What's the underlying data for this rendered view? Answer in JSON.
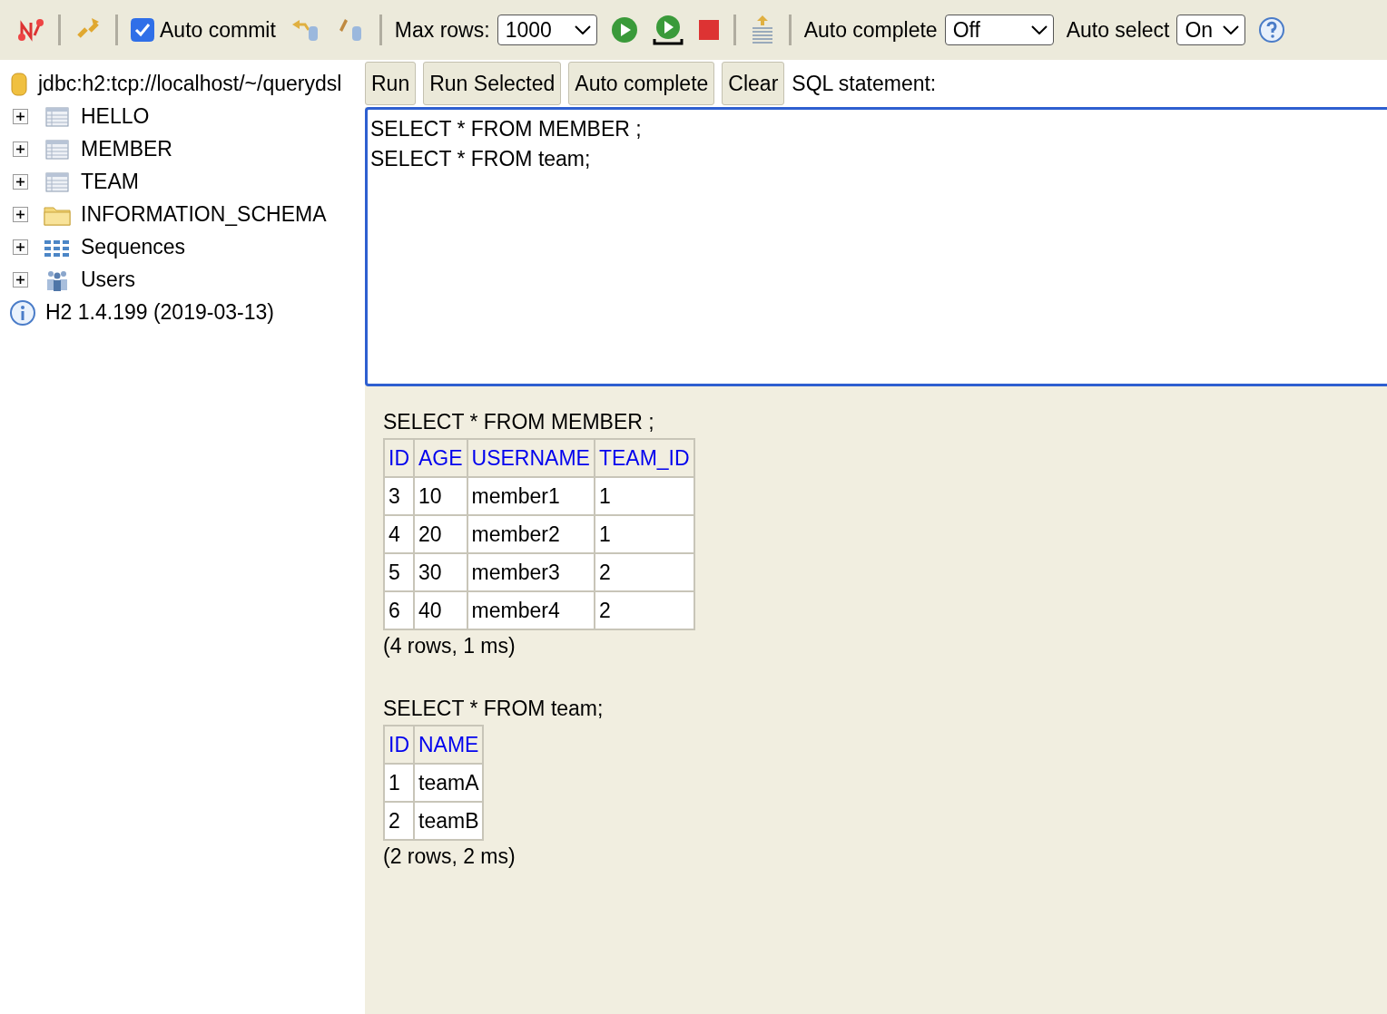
{
  "toolbar": {
    "auto_commit": {
      "label": "Auto commit",
      "checked": true
    },
    "max_rows": {
      "label": "Max rows:",
      "value": "1000"
    },
    "auto_complete": {
      "label": "Auto complete",
      "value": "Off"
    },
    "auto_select": {
      "label": "Auto select",
      "value": "On"
    }
  },
  "sidebar": {
    "connection": "jdbc:h2:tcp://localhost/~/querydsl",
    "items": [
      {
        "kind": "table",
        "label": "HELLO",
        "expanded": false
      },
      {
        "kind": "table",
        "label": "MEMBER",
        "expanded": false
      },
      {
        "kind": "table",
        "label": "TEAM",
        "expanded": false
      },
      {
        "kind": "folder",
        "label": "INFORMATION_SCHEMA",
        "expanded": false
      },
      {
        "kind": "sequences",
        "label": "Sequences",
        "expanded": false
      },
      {
        "kind": "users",
        "label": "Users",
        "expanded": false
      }
    ],
    "version": "H2 1.4.199 (2019-03-13)"
  },
  "query_bar": {
    "buttons": [
      "Run",
      "Run Selected",
      "Auto complete",
      "Clear"
    ],
    "label": "SQL statement:"
  },
  "editor": {
    "value": "SELECT * FROM MEMBER ;\nSELECT * FROM team;"
  },
  "results": [
    {
      "query": "SELECT * FROM MEMBER ;",
      "columns": [
        "ID",
        "AGE",
        "USERNAME",
        "TEAM_ID"
      ],
      "rows": [
        [
          "3",
          "10",
          "member1",
          "1"
        ],
        [
          "4",
          "20",
          "member2",
          "1"
        ],
        [
          "5",
          "30",
          "member3",
          "2"
        ],
        [
          "6",
          "40",
          "member4",
          "2"
        ]
      ],
      "footer": "(4 rows, 1 ms)"
    },
    {
      "query": "SELECT * FROM team;",
      "columns": [
        "ID",
        "NAME"
      ],
      "rows": [
        [
          "1",
          "teamA"
        ],
        [
          "2",
          "teamB"
        ]
      ],
      "footer": "(2 rows, 2 ms)"
    }
  ]
}
